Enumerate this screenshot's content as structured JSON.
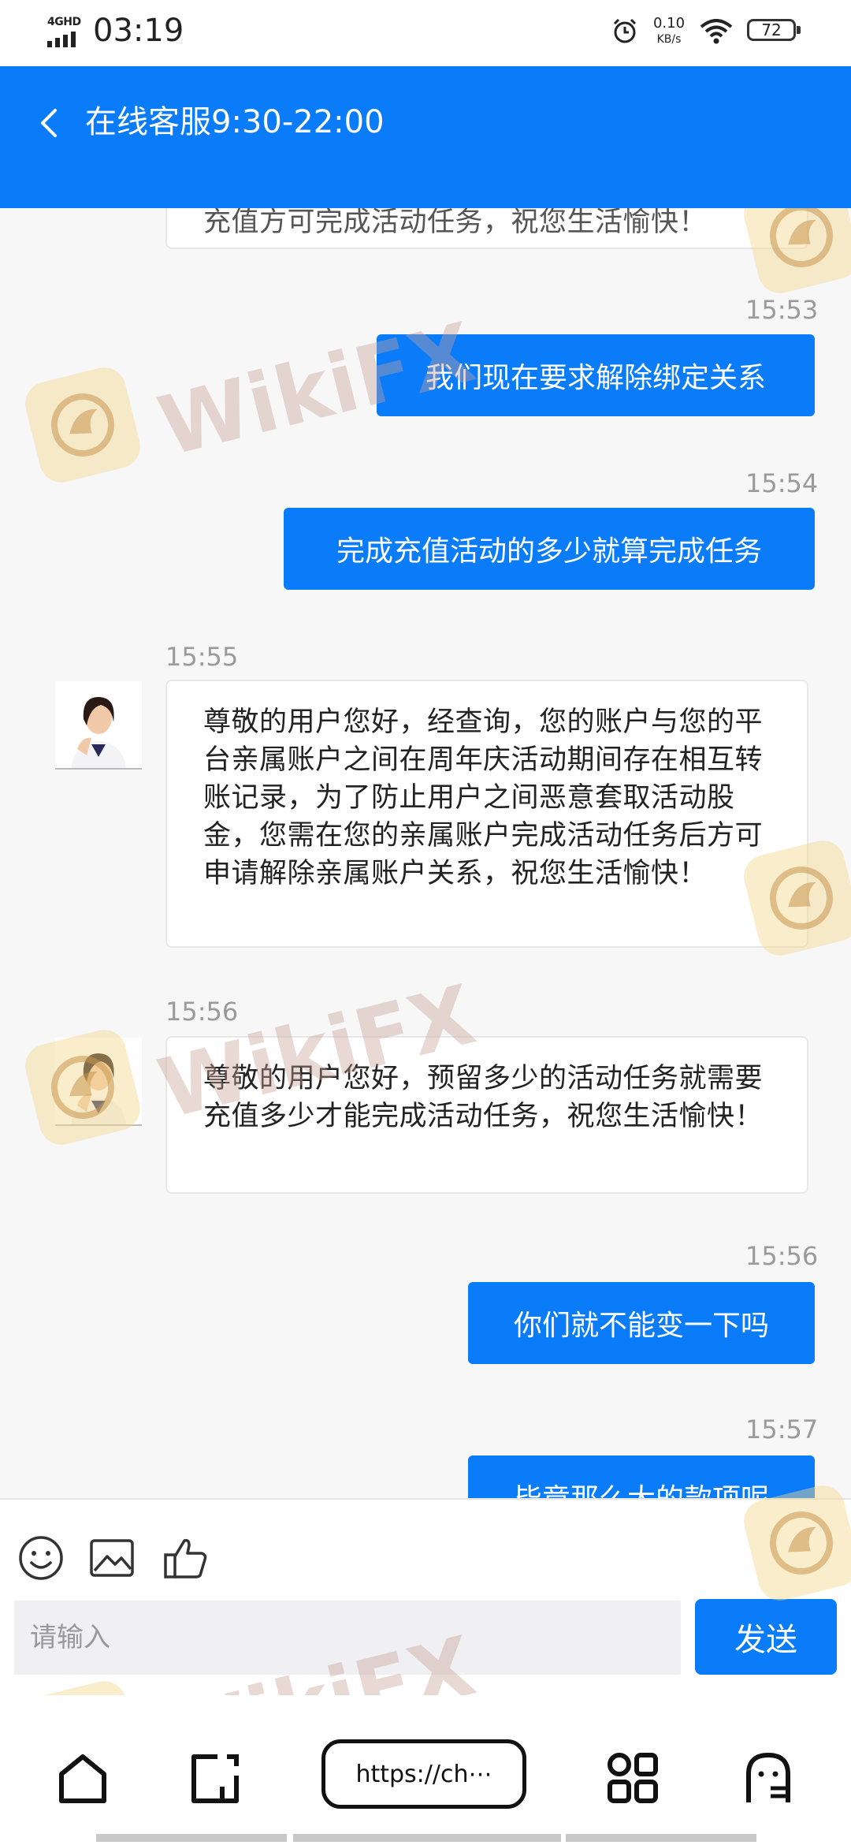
{
  "status_bar": {
    "network": "4GHD",
    "time": "03:19",
    "speed_value": "0.10",
    "speed_unit": "KB/s",
    "battery": "72"
  },
  "header": {
    "title": "在线客服9:30-22:00"
  },
  "messages": [
    {
      "side": "left",
      "text": "充值方可完成活动任务，祝您生活愉快！"
    },
    {
      "side": "right",
      "time": "15:53",
      "text": "我们现在要求解除绑定关系"
    },
    {
      "side": "right",
      "time": "15:54",
      "text": "完成充值活动的多少就算完成任务"
    },
    {
      "side": "left",
      "time": "15:55",
      "text": "尊敬的用户您好，经查询，您的账户与您的平台亲属账户之间在周年庆活动期间存在相互转账记录，为了防止用户之间恶意套取活动股金，您需在您的亲属账户完成活动任务后方可申请解除亲属账户关系，祝您生活愉快！"
    },
    {
      "side": "left",
      "time": "15:56",
      "text": "尊敬的用户您好，预留多少的活动任务就需要充值多少才能完成活动任务，祝您生活愉快！"
    },
    {
      "side": "right",
      "time": "15:56",
      "text": "你们就不能变一下吗"
    },
    {
      "side": "right",
      "time": "15:57",
      "text": "毕竟那么大的款项呢"
    }
  ],
  "watermark": {
    "text": "WikiFX"
  },
  "input": {
    "placeholder": "请输入",
    "send_label": "发送"
  },
  "browser": {
    "url": "https://ch⋯"
  },
  "colors": {
    "accent": "#0a7cfa",
    "background": "#f7f7f7"
  }
}
